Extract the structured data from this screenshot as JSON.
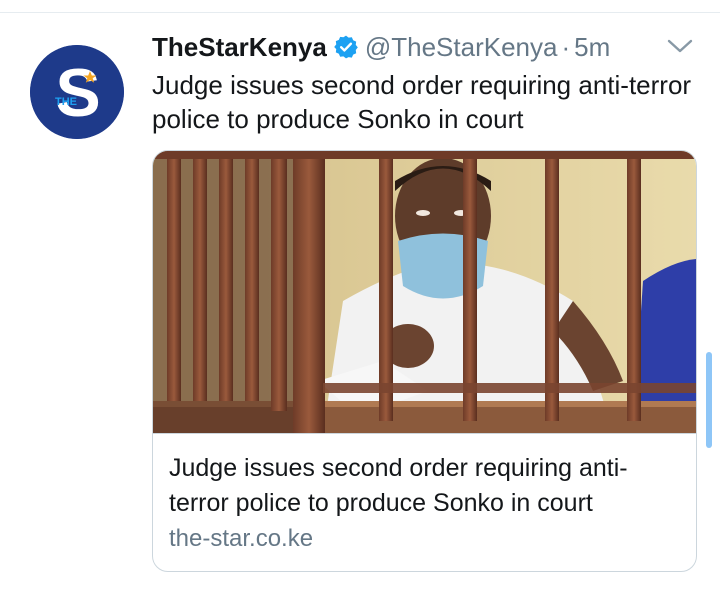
{
  "tweet": {
    "display_name": "TheStarKenya",
    "handle": "@TheStarKenya",
    "separator": "·",
    "time": "5m",
    "text": "Judge issues second order requiring anti-terror police to produce Sonko in court",
    "avatar": {
      "letter": "S",
      "small_text": "THE",
      "bg_color": "#1e3a8a",
      "icon": "star-logo"
    },
    "verified_icon": "verified-badge-icon",
    "menu_icon": "chevron-down-icon"
  },
  "card": {
    "title": "Judge issues second order requiring anti-terror police to produce Sonko in court",
    "domain": "the-star.co.ke",
    "image_description": "man-behind-bars-photo"
  },
  "colors": {
    "verified_blue": "#1da1f2",
    "secondary_text": "#657786",
    "border": "#ccd6dd",
    "scrollbar": "#8ec6f7"
  }
}
